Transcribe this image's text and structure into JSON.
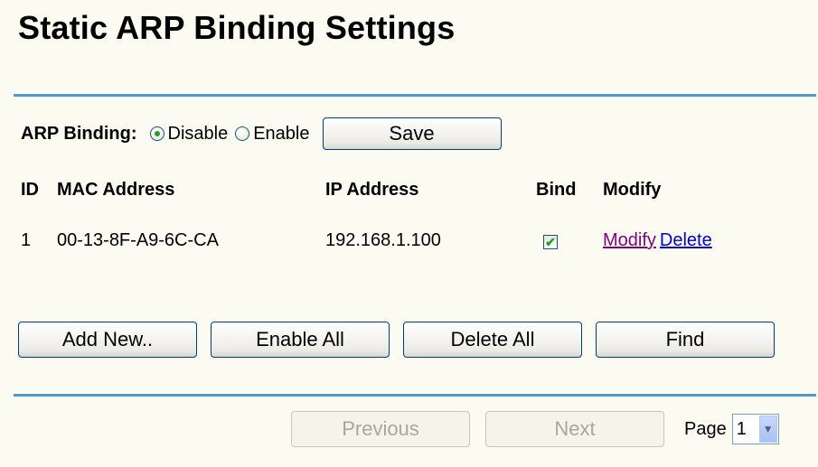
{
  "page": {
    "title": "Static ARP Binding Settings"
  },
  "binding": {
    "label": "ARP Binding:",
    "options": [
      {
        "label": "Disable",
        "selected": true
      },
      {
        "label": "Enable",
        "selected": false
      }
    ],
    "save_label": "Save"
  },
  "table": {
    "headers": {
      "id": "ID",
      "mac": "MAC Address",
      "ip": "IP Address",
      "bind": "Bind",
      "modify": "Modify"
    },
    "rows": [
      {
        "id": "1",
        "mac": "00-13-8F-A9-6C-CA",
        "ip": "192.168.1.100",
        "bind": true,
        "modify_label": "Modify",
        "delete_label": "Delete"
      }
    ]
  },
  "actions": {
    "add_new": "Add New..",
    "enable_all": "Enable All",
    "delete_all": "Delete All",
    "find": "Find"
  },
  "pager": {
    "previous": "Previous",
    "next": "Next",
    "page_label": "Page",
    "current_page": "1"
  },
  "colors": {
    "background": "#fbfbf1",
    "rule": "#4a9dcd",
    "link_visited": "#800080",
    "link": "#0000cc",
    "check": "#21a121"
  }
}
